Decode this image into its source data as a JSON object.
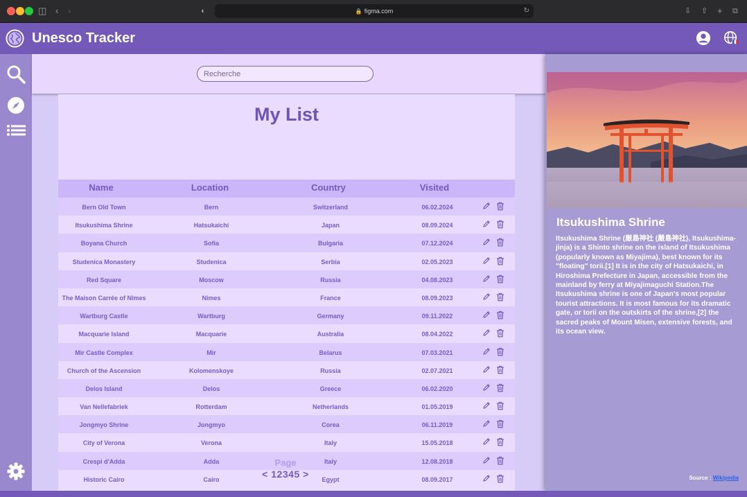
{
  "browser": {
    "url": "figma.com"
  },
  "app": {
    "title": "Unesco Tracker"
  },
  "search": {
    "placeholder": "Recherche"
  },
  "list": {
    "title": "My List",
    "columns": {
      "name": "Name",
      "location": "Location",
      "country": "Country",
      "visited": "Visited"
    },
    "rows": [
      {
        "name": "Bern Old Town",
        "location": "Bern",
        "country": "Switzerland",
        "visited": "06.02.2024"
      },
      {
        "name": "Itsukushima Shrine",
        "location": "Hatsukaichi",
        "country": "Japan",
        "visited": "08.09.2024"
      },
      {
        "name": "Boyana Church",
        "location": "Sofia",
        "country": "Bulgaria",
        "visited": "07.12.2024"
      },
      {
        "name": "Studenica Monastery",
        "location": "Studenica",
        "country": "Serbia",
        "visited": "02.05.2023"
      },
      {
        "name": "Red Square",
        "location": "Moscow",
        "country": "Russia",
        "visited": "04.08.2023"
      },
      {
        "name": "The Maison Carrée of Nîmes",
        "location": "Nimes",
        "country": "France",
        "visited": "08.09.2023"
      },
      {
        "name": "Wartburg Castle",
        "location": "Wartburg",
        "country": "Germany",
        "visited": "09.11.2022"
      },
      {
        "name": "Macquarie Island",
        "location": "Macquarie",
        "country": "Australia",
        "visited": "08.04.2022"
      },
      {
        "name": "Mir Castle Complex",
        "location": "Mir",
        "country": "Belarus",
        "visited": "07.03.2021"
      },
      {
        "name": "Church of the Ascension",
        "location": "Kolomenskoye",
        "country": "Russia",
        "visited": "02.07.2021"
      },
      {
        "name": "Delos Island",
        "location": "Delos",
        "country": "Greece",
        "visited": "06.02.2020"
      },
      {
        "name": "Van Nellefabriek",
        "location": "Rotterdam",
        "country": "Netherlands",
        "visited": "01.05.2019"
      },
      {
        "name": "Jongmyo Shrine",
        "location": "Jongmyo",
        "country": "Corea",
        "visited": "06.11.2019"
      },
      {
        "name": "City of Verona",
        "location": "Verona",
        "country": "Italy",
        "visited": "15.05.2018"
      },
      {
        "name": "Crespi d'Adda",
        "location": "Adda",
        "country": "Italy",
        "visited": "12.08.2018"
      },
      {
        "name": "Historic Cairo",
        "location": "Cairo",
        "country": "Egypt",
        "visited": "08.09.2017"
      }
    ]
  },
  "pagination": {
    "label": "Page",
    "prev": "<",
    "pages": [
      "1",
      "2",
      "3",
      "4",
      "5"
    ],
    "next": ">"
  },
  "detail": {
    "title": "Itsukushima Shrine",
    "description": "Itsukushima Shrine (厳島神社 (嚴島神社), Itsukushima-jinja) is a Shinto shrine on the island of Itsukushima (popularly known as Miyajima), best known for its \"floating\" torii.[1] It is in the city of Hatsukaichi, in Hiroshima Prefecture in Japan, accessible from the mainland by ferry at Miyajimaguchi Station.The Itsukushima shrine is one of Japan's most popular tourist attractions. It is most famous for its dramatic gate, or torii on the outskirts of the shrine,[2] the sacred peaks of Mount Misen, extensive forests, and its ocean view.",
    "source_label": "Source :",
    "source_link": "Wikipedia"
  },
  "colors": {
    "topbar": "#7459b8",
    "sidebar": "#9a88cf",
    "accent": "#7152b5",
    "row_odd": "#dccbfc",
    "row_even": "#eadcfe"
  },
  "icons": [
    "globe-logo-icon",
    "account-icon",
    "language-globe-icon",
    "search-icon",
    "compass-icon",
    "list-icon",
    "settings-gear-icon",
    "edit-pencil-icon",
    "trash-icon"
  ]
}
